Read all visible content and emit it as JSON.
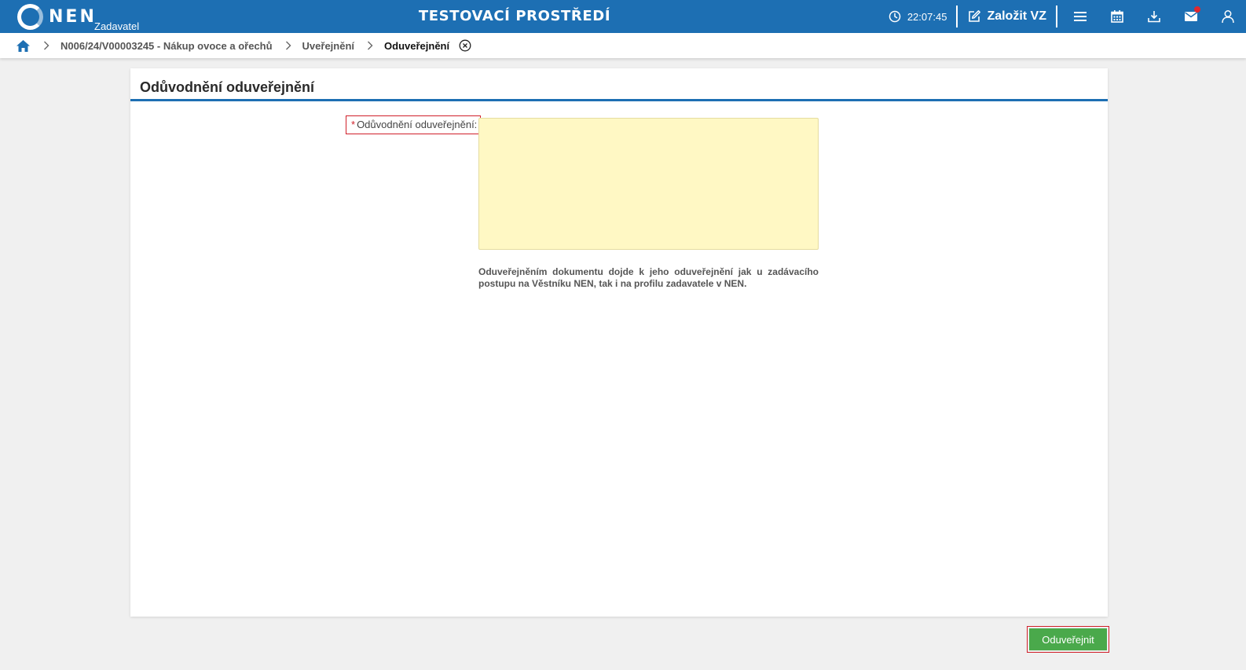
{
  "header": {
    "logo_text": "NEN",
    "logo_sub": "Zadavatel",
    "env_title": "TESTOVACÍ PROSTŘEDÍ",
    "clock": "22:07:45",
    "create_label": "Založit VZ",
    "icons": [
      "clock-icon",
      "edit-icon",
      "menu-icon",
      "calendar-icon",
      "download-icon",
      "mail-icon",
      "user-icon"
    ],
    "notification_color": "#e0282e"
  },
  "breadcrumb": {
    "items": [
      "N006/24/V00003245 - Nákup ovoce a ořechů",
      "Uveřejnění",
      "Oduveřejnění"
    ]
  },
  "card": {
    "title": "Odůvodnění oduveřejnění",
    "field": {
      "required_mark": "*",
      "label": "Odůvodnění oduveřejnění:",
      "value": "",
      "hint": "Oduveřejněním dokumentu dojde k jeho oduveřejnění jak u zadávacího postupu na Věstníku NEN, tak i na profilu zadavatele v NEN."
    }
  },
  "actions": {
    "submit_label": "Oduveřejnit"
  },
  "colors": {
    "brand": "#1d6fb3",
    "field_bg": "#fff8c4",
    "submit": "#4aa94b",
    "required": "#d0202a"
  }
}
